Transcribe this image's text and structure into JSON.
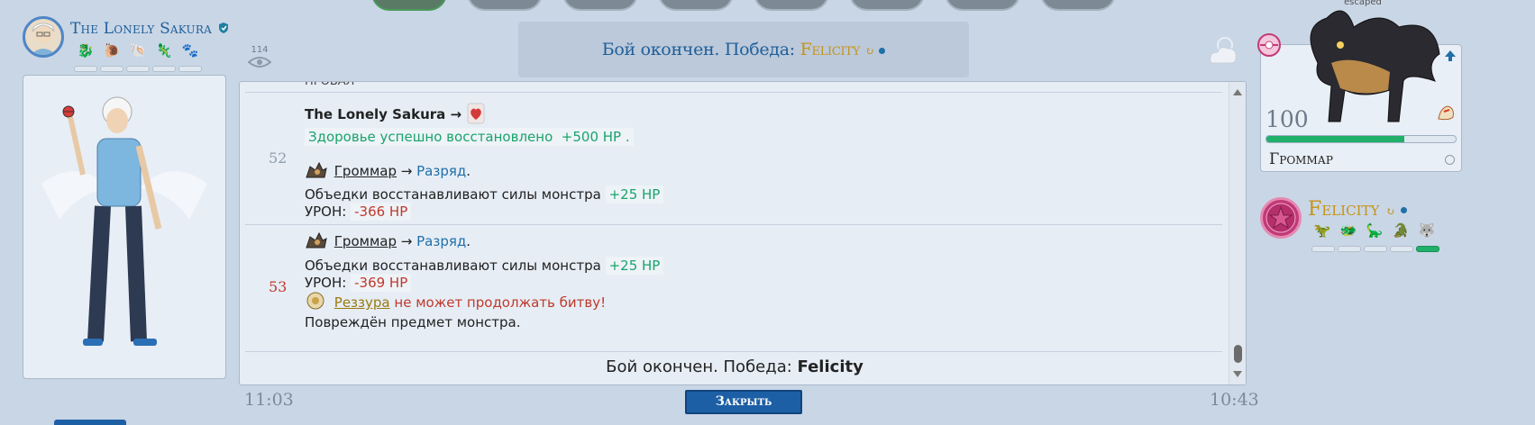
{
  "player": {
    "name": "The Lonely Sakura",
    "team_icons": [
      "monster-icon",
      "monster-icon",
      "monster-icon",
      "monster-icon",
      "monster-icon"
    ]
  },
  "header": {
    "view_count": "114",
    "result_prefix": "Бой окончен. Победа:",
    "winner": "Felicity"
  },
  "log": {
    "partial_top": "ПРОБАЛ",
    "turns": [
      {
        "number": "52",
        "actor": "The Lonely Sakura",
        "arrow": "→",
        "heal_text": "Здоровье успешно восстановлено",
        "heal_value": "+500 HP",
        "heal_dot": ".",
        "mon_line_name": "Громмар",
        "mon_line_arrow": "→",
        "mon_line_skill": "Разряд",
        "leftovers_text": "Объедки восстанавливают силы монстра",
        "leftovers_value": "+25 HP",
        "damage_label": "УРОН:",
        "damage_value": "-366 HP"
      },
      {
        "number": "53",
        "mon_line_name": "Громмар",
        "mon_line_arrow": "→",
        "mon_line_skill": "Разряд",
        "leftovers_text": "Объедки восстанавливают силы монстра",
        "leftovers_value": "+25 HP",
        "damage_label": "УРОН:",
        "damage_value": "-369 HP",
        "faint_name": "Реззура",
        "faint_text": "не может продолжать битву!",
        "item_text": "Повреждён предмет монстра."
      }
    ],
    "footer_prefix": "Бой окончен. Победа:",
    "footer_winner": "Felicity"
  },
  "bottom": {
    "time_left": "11:03",
    "time_right": "10:43",
    "close_label": "Закрыть"
  },
  "monster_card": {
    "escaped_label": "escaped",
    "level": "100",
    "hp_fraction": 0.73,
    "name": "Громмар"
  },
  "opponent": {
    "name": "Felicity",
    "team_hp": [
      0,
      0,
      0,
      0,
      1
    ]
  },
  "colors": {
    "accent_blue": "#1f5f9a",
    "winner_gold": "#c59318",
    "hp_green": "#20b06a",
    "damage_red": "#c0392b"
  }
}
